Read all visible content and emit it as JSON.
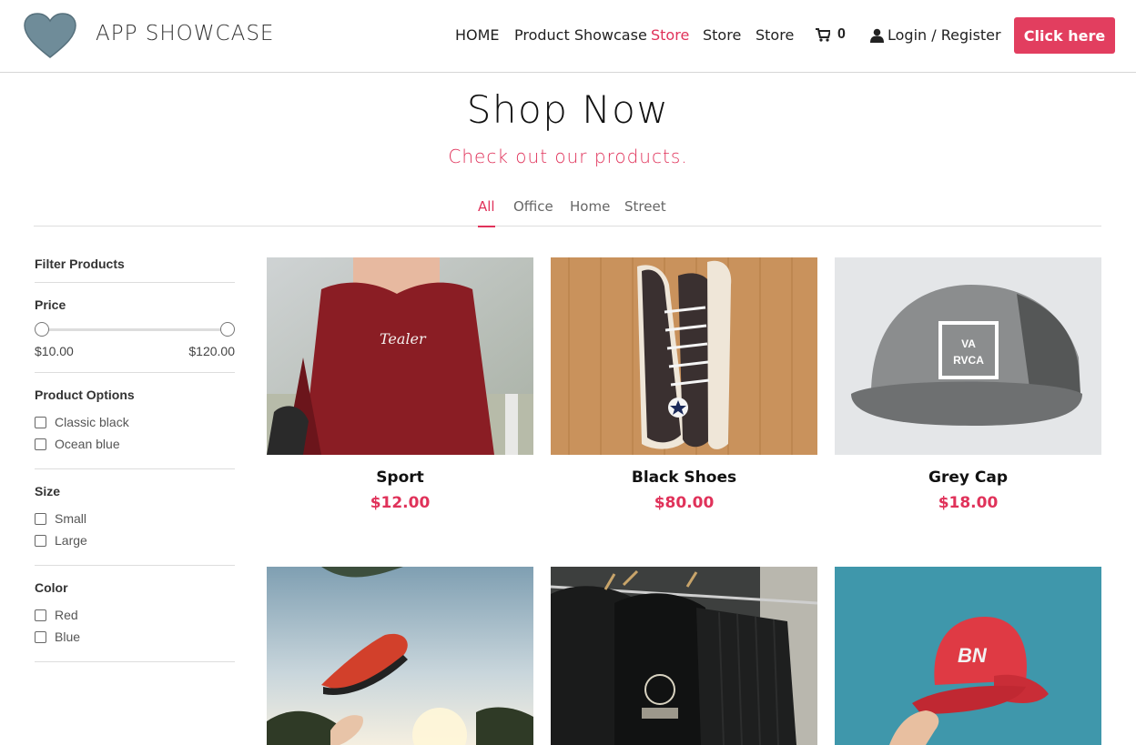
{
  "brand": {
    "name": "APP SHOWCASE"
  },
  "nav": {
    "items": [
      {
        "label": "HOME"
      },
      {
        "label": "Product Showcase"
      },
      {
        "label": "Store"
      },
      {
        "label": "Store"
      },
      {
        "label": "Store"
      }
    ],
    "cart_count": "0",
    "login_label": "Login / Register",
    "cta_label": "Click here"
  },
  "hero": {
    "title": "Shop Now",
    "subtitle": "Check out our products."
  },
  "tabs": [
    {
      "label": "All",
      "active": true
    },
    {
      "label": "Office"
    },
    {
      "label": "Home"
    },
    {
      "label": "Street"
    }
  ],
  "filters": {
    "heading": "Filter Products",
    "price": {
      "title": "Price",
      "min_label": "$10.00",
      "max_label": "$120.00"
    },
    "product_options": {
      "title": "Product Options",
      "options": [
        "Classic black",
        "Ocean blue"
      ]
    },
    "size": {
      "title": "Size",
      "options": [
        "Small",
        "Large"
      ]
    },
    "color": {
      "title": "Color",
      "options": [
        "Red",
        "Blue"
      ]
    }
  },
  "products": [
    {
      "name": "Sport",
      "price": "$12.00"
    },
    {
      "name": "Black Shoes",
      "price": "$80.00"
    },
    {
      "name": "Grey Cap",
      "price": "$18.00"
    },
    {
      "name": "",
      "price": ""
    },
    {
      "name": "",
      "price": ""
    },
    {
      "name": "",
      "price": ""
    }
  ],
  "colors": {
    "accent": "#e0325a",
    "cta": "#e23e5f",
    "logo": "#6f8c99"
  }
}
